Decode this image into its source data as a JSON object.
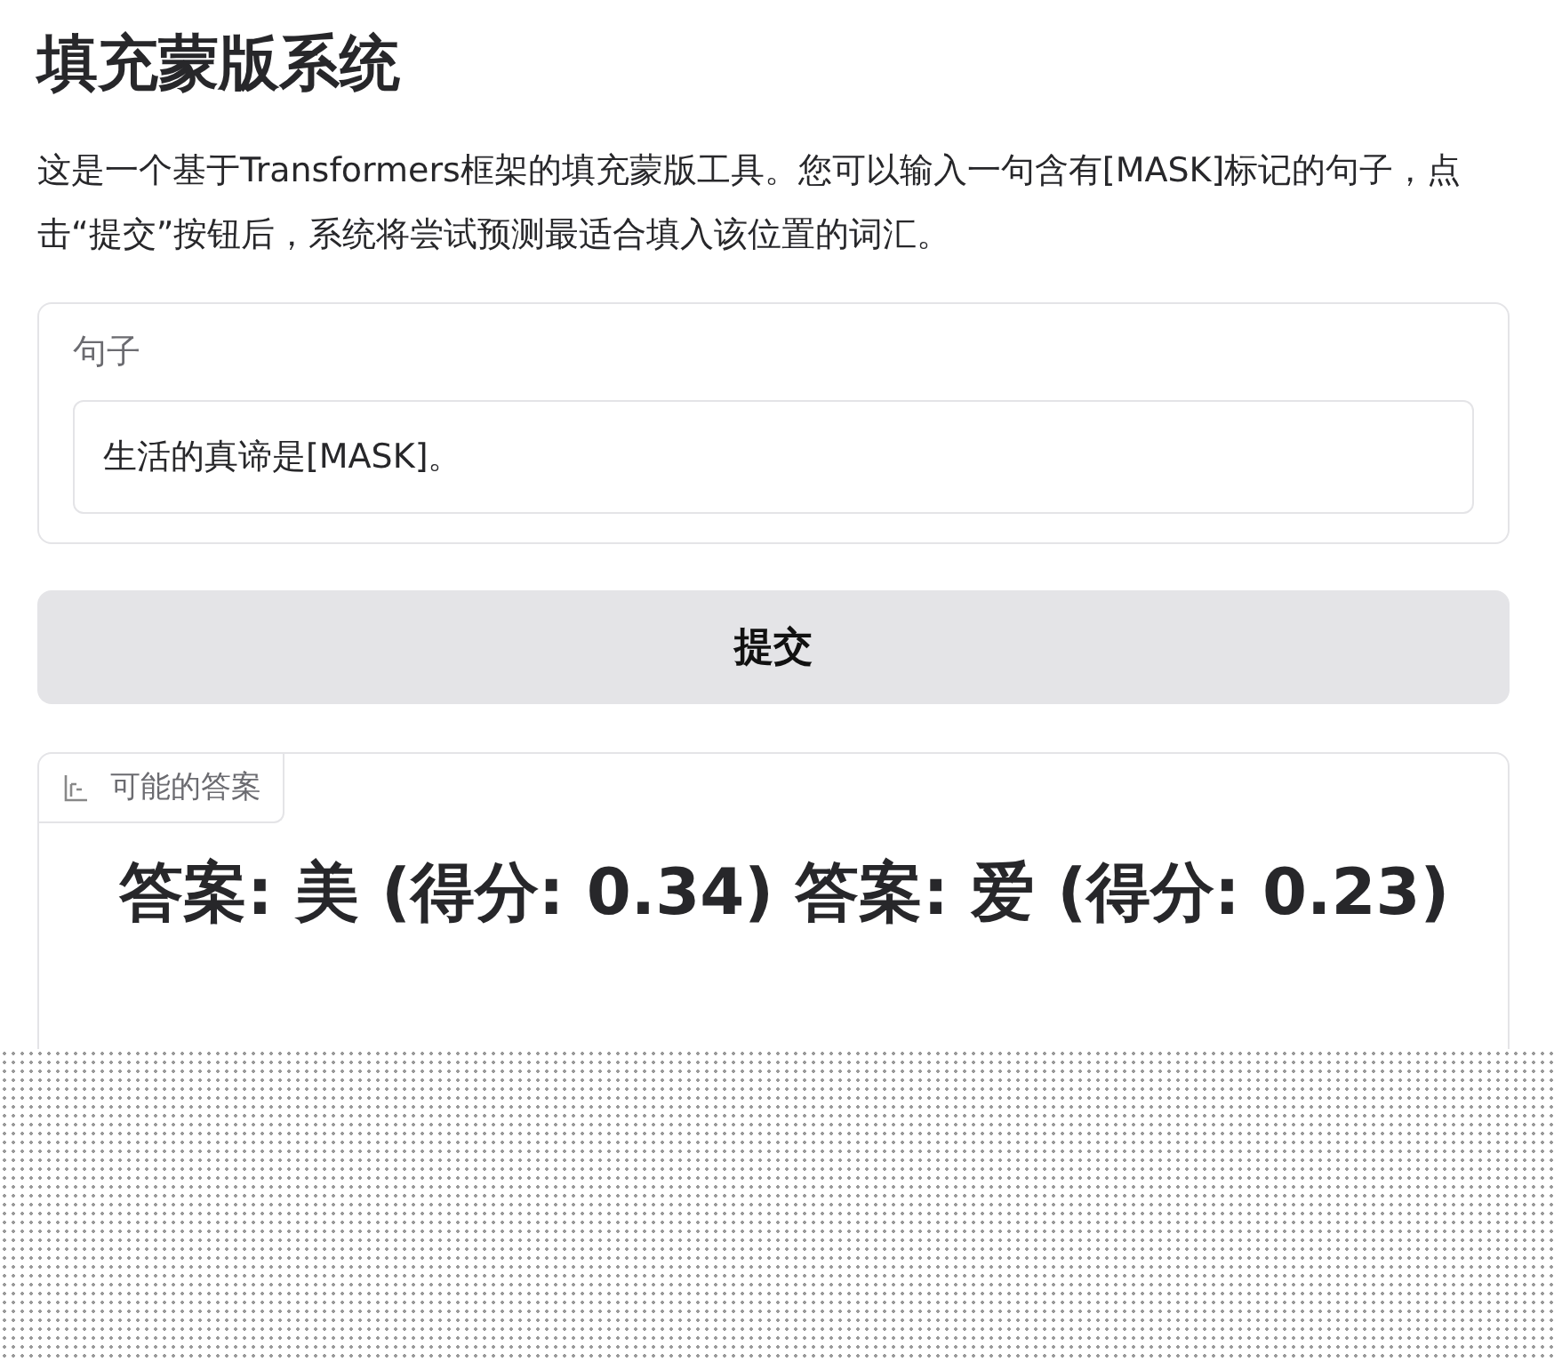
{
  "title": "填充蒙版系统",
  "description": "这是一个基于Transformers框架的填充蒙版工具。您可以输入一句含有[MASK]标记的句子，点击“提交”按钮后，系统将尝试预测最适合填入该位置的词汇。",
  "input": {
    "label": "句子",
    "value": "生活的真谛是[MASK]。"
  },
  "submit_button": "提交",
  "output": {
    "label": "可能的答案",
    "answers": [
      "答案: 美 (得分: 0.34)",
      "答案: 爱 (得分: 0.23)"
    ]
  }
}
